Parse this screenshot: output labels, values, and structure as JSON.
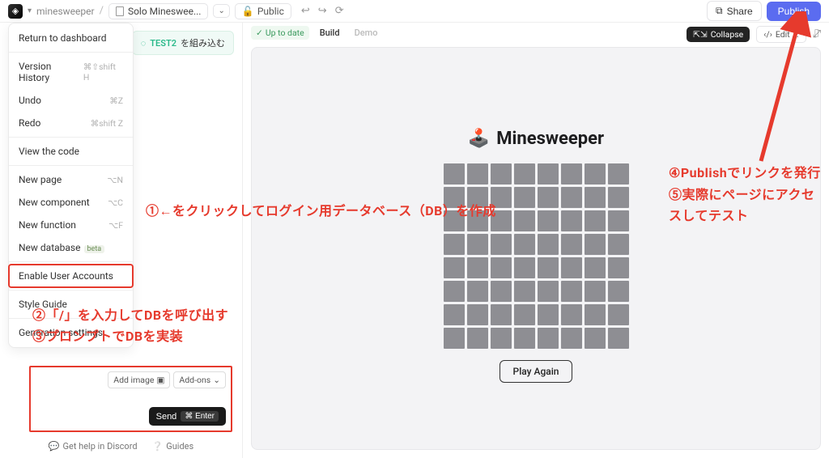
{
  "topbar": {
    "project": "minesweeper",
    "page_name": "Solo Mineswee...",
    "visibility": "Public",
    "share": "Share",
    "publish": "Publish"
  },
  "dropdown": {
    "return": "Return to dashboard",
    "version_history": "Version History",
    "version_history_sc": "⌘⇧shift H",
    "undo": "Undo",
    "undo_sc": "⌘Z",
    "redo": "Redo",
    "redo_sc": "⌘shift Z",
    "view_code": "View the code",
    "new_page": "New page",
    "new_page_sc": "⌥N",
    "new_component": "New component",
    "new_component_sc": "⌥C",
    "new_function": "New function",
    "new_function_sc": "⌥F",
    "new_database": "New database",
    "beta_tag": "beta",
    "enable_accounts": "Enable User Accounts",
    "style_guide": "Style Guide",
    "gen_settings": "Generation settings"
  },
  "test_chip": {
    "name": "TEST2",
    "suffix": "を組み込む"
  },
  "prompt": {
    "add_image": "Add image",
    "addons": "Add-ons",
    "send": "Send",
    "send_kbd": "⌘ Enter"
  },
  "footer": {
    "discord": "Get help in Discord",
    "guides": "Guides"
  },
  "canvas": {
    "status": "Up to date",
    "build": "Build",
    "demo": "Demo",
    "collapse": "Collapse",
    "edit": "Edit ...",
    "title": "Minesweeper",
    "play_again": "Play Again"
  },
  "grid": {
    "rows": 8,
    "cols": 8
  },
  "annotations": {
    "a1": "①←をクリックしてログイン用データベース（DB）を作成",
    "a2": "②「/」を入力してDBを呼び出す",
    "a3": "③プロンプトでDBを実装",
    "a4": "④Publishでリンクを発行",
    "a5": "⑤実際にページにアクセスしてテスト"
  }
}
